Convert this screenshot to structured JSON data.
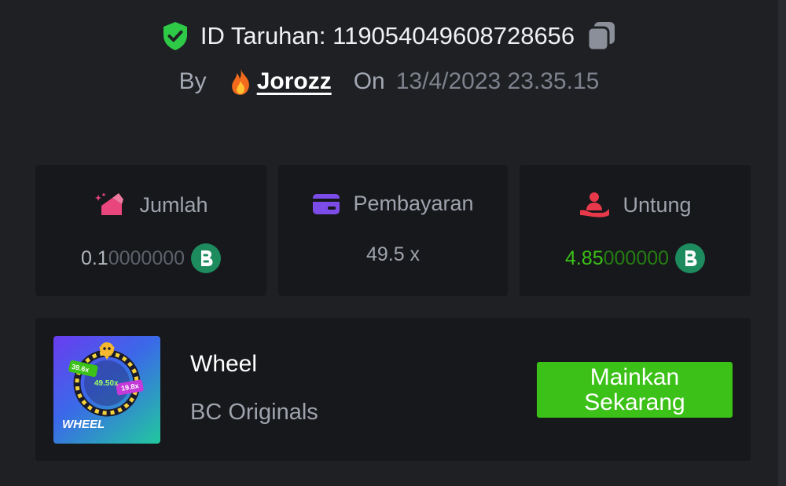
{
  "bet": {
    "id_label": "ID Taruhan: 1190540496087286​56",
    "by_label": "By",
    "username": "Jorozz",
    "on_label": "On",
    "date": "13/4/2023 23.35.15"
  },
  "stats": [
    {
      "label": "Jumlah",
      "value_main": "0.1",
      "value_fade": "0000000",
      "icon": "bet-amount-icon",
      "color": "#e8467c"
    },
    {
      "label": "Pembayaran",
      "value_main": "49.5 x",
      "value_fade": "",
      "icon": "card-icon",
      "color": "#7c4ce8"
    },
    {
      "label": "Untung",
      "value_main": "4.85",
      "value_fade": "000000",
      "icon": "profit-hand-icon",
      "color": "#e8394a"
    }
  ],
  "game": {
    "thumb_label": "WHEEL",
    "thumb_mult_1": "39.6x",
    "thumb_mult_2": "49.50x",
    "thumb_mult_3": "19.8x",
    "title": "Wheel",
    "provider": "BC Originals",
    "play_line1": "Mainkan",
    "play_line2": "Sekarang"
  },
  "colors": {
    "verified": "#2ec947",
    "profit": "#3bc117",
    "button": "#3bc117",
    "coin": "#1d8b5e"
  }
}
